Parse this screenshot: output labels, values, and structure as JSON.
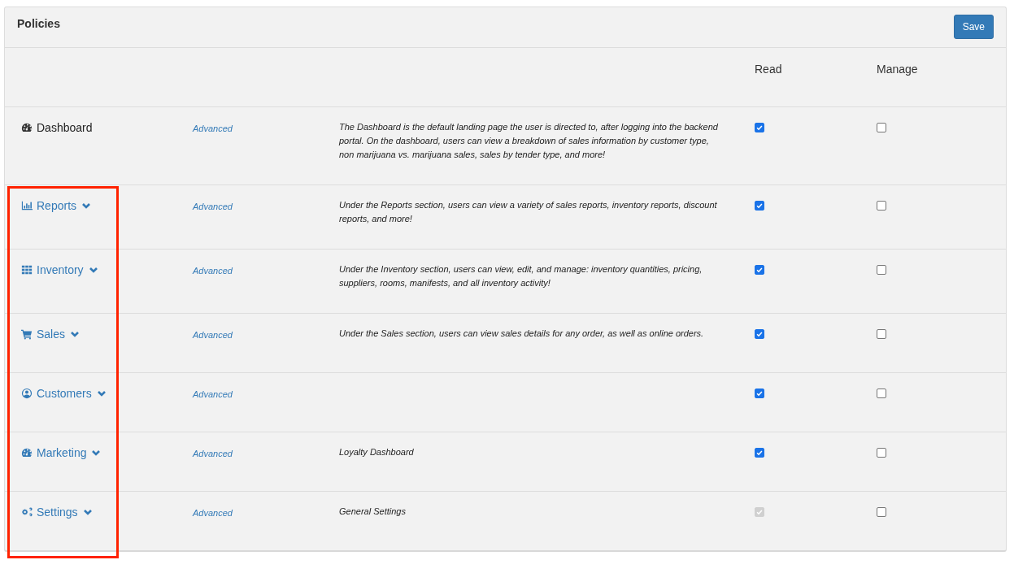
{
  "panel": {
    "title": "Policies",
    "save_button": "Save"
  },
  "columns": {
    "read": "Read",
    "manage": "Manage"
  },
  "rows": [
    {
      "name": "Dashboard",
      "expandable": false,
      "advanced": "Advanced",
      "description": "The Dashboard is the default landing page the user is directed to, after logging into the backend portal. On the dashboard, users can view a breakdown of sales information by customer type, non marijuana vs. marijuana sales, sales by tender type, and more!",
      "read": {
        "checked": true,
        "disabled": false
      },
      "manage": {
        "checked": false,
        "disabled": false
      }
    },
    {
      "name": "Reports",
      "expandable": true,
      "advanced": "Advanced",
      "description": "Under the Reports section, users can view a variety of sales reports, inventory reports, discount reports, and more!",
      "read": {
        "checked": true,
        "disabled": false
      },
      "manage": {
        "checked": false,
        "disabled": false
      }
    },
    {
      "name": "Inventory",
      "expandable": true,
      "advanced": "Advanced",
      "description": "Under the Inventory section, users can view, edit, and manage: inventory quantities, pricing, suppliers, rooms, manifests, and all inventory activity!",
      "read": {
        "checked": true,
        "disabled": false
      },
      "manage": {
        "checked": false,
        "disabled": false
      }
    },
    {
      "name": "Sales",
      "expandable": true,
      "advanced": "Advanced",
      "description": "Under the Sales section, users can view sales details for any order, as well as online orders.",
      "read": {
        "checked": true,
        "disabled": false
      },
      "manage": {
        "checked": false,
        "disabled": false
      }
    },
    {
      "name": "Customers",
      "expandable": true,
      "advanced": "Advanced",
      "read": {
        "checked": true,
        "disabled": false
      },
      "manage": {
        "checked": false,
        "disabled": false
      }
    },
    {
      "name": "Marketing",
      "expandable": true,
      "advanced": "Advanced",
      "description": "Loyalty Dashboard",
      "read": {
        "checked": true,
        "disabled": false
      },
      "manage": {
        "checked": false,
        "disabled": false
      }
    },
    {
      "name": "Settings",
      "expandable": true,
      "advanced": "Advanced",
      "description": "General Settings",
      "read": {
        "checked": true,
        "disabled": true
      },
      "manage": {
        "checked": false,
        "disabled": false
      }
    }
  ]
}
